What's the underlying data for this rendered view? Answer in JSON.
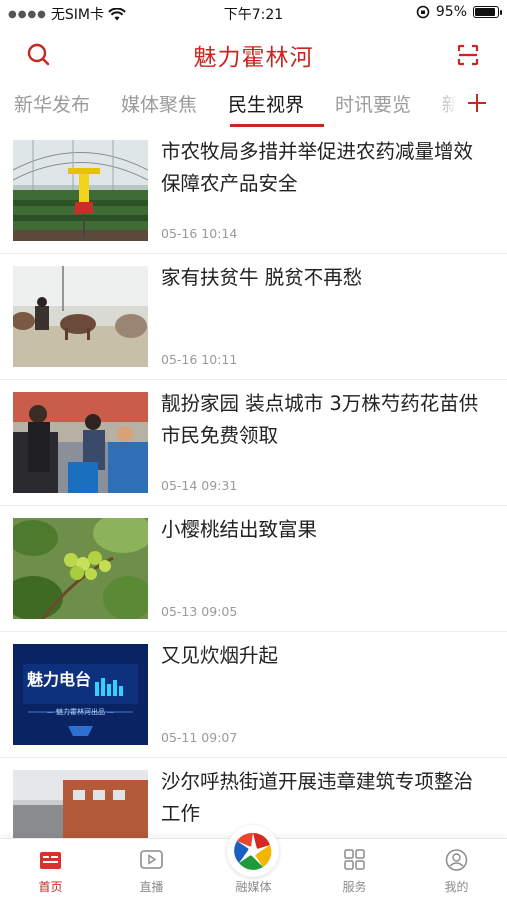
{
  "status_bar": {
    "carrier": "无SIM卡",
    "time": "下午7:21",
    "battery_text": "95%",
    "battery_level": 0.95
  },
  "header": {
    "title": "魅力霍林河"
  },
  "tabs": {
    "items": [
      {
        "label": "新华发布"
      },
      {
        "label": "媒体聚焦"
      },
      {
        "label": "民生视界"
      },
      {
        "label": "时讯要览"
      },
      {
        "label": "新"
      }
    ],
    "active_index": 2
  },
  "news": [
    {
      "title": "市农牧局多措并举促进农药减量增效 保障农产品安全",
      "time": "05-16 10:14"
    },
    {
      "title": "家有扶贫牛 脱贫不再愁",
      "time": "05-16 10:11"
    },
    {
      "title": "靓扮家园 装点城市 3万株芍药花苗供市民免费领取",
      "time": "05-14 09:31"
    },
    {
      "title": "小樱桃结出致富果",
      "time": "05-13 09:05"
    },
    {
      "title": "又见炊烟升起",
      "time": "05-11 09:07"
    },
    {
      "title": "沙尔呼热街道开展违章建筑专项整治工作",
      "time": ""
    }
  ],
  "thumb_text": {
    "radio_logo": "魅力电台",
    "radio_sub": "— 魅力霍林河出品 —"
  },
  "bottom_nav": {
    "items": [
      {
        "label": "首页"
      },
      {
        "label": "直播"
      },
      {
        "label": "融媒体"
      },
      {
        "label": "服务"
      },
      {
        "label": "我的"
      }
    ],
    "active_index": 0
  },
  "colors": {
    "brand": "#c8261f",
    "tab_inactive": "#9b9b9b",
    "time_text": "#9a9a9a"
  }
}
